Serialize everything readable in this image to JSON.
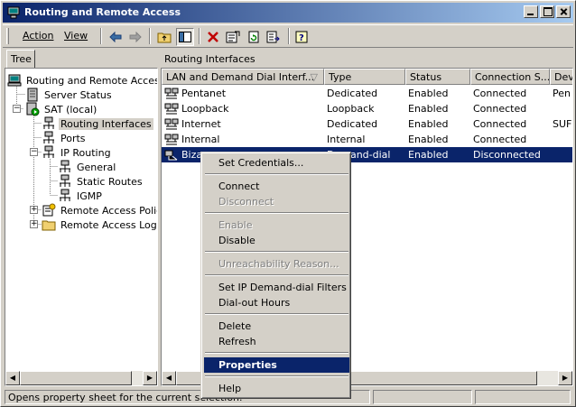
{
  "window": {
    "title": "Routing and Remote Access"
  },
  "menu": {
    "action": "Action",
    "view": "View"
  },
  "tree": {
    "tab_label": "Tree",
    "items": [
      {
        "label": "Routing and Remote Access"
      },
      {
        "label": "Server Status"
      },
      {
        "label": "SAT (local)"
      },
      {
        "label": "Routing Interfaces"
      },
      {
        "label": "Ports"
      },
      {
        "label": "IP Routing"
      },
      {
        "label": "General"
      },
      {
        "label": "Static Routes"
      },
      {
        "label": "IGMP"
      },
      {
        "label": "Remote Access Policies"
      },
      {
        "label": "Remote Access Logging"
      }
    ]
  },
  "list": {
    "pane_title": "Routing Interfaces",
    "columns": [
      "LAN and Demand Dial Interf...",
      "Type",
      "Status",
      "Connection S...",
      "Dev"
    ],
    "rows": [
      {
        "name": "Pentanet",
        "type": "Dedicated",
        "status": "Enabled",
        "connection": "Connected",
        "device": "Pen"
      },
      {
        "name": "Loopback",
        "type": "Loopback",
        "status": "Enabled",
        "connection": "Connected",
        "device": ""
      },
      {
        "name": "Internet",
        "type": "Dedicated",
        "status": "Enabled",
        "connection": "Connected",
        "device": "SUF"
      },
      {
        "name": "Internal",
        "type": "Internal",
        "status": "Enabled",
        "connection": "Connected",
        "device": ""
      },
      {
        "name": "Bizarr",
        "type": "Demand-dial",
        "status": "Enabled",
        "connection": "Disconnected",
        "device": ""
      }
    ]
  },
  "context_menu": {
    "set_credentials": "Set Credentials...",
    "connect": "Connect",
    "disconnect": "Disconnect",
    "enable": "Enable",
    "disable": "Disable",
    "unreachability": "Unreachability Reason...",
    "set_filters": "Set IP Demand-dial Filters",
    "dialout_hours": "Dial-out Hours",
    "delete": "Delete",
    "refresh": "Refresh",
    "properties": "Properties",
    "help": "Help"
  },
  "status": {
    "text": "Opens property sheet for the current selection."
  },
  "colors": {
    "title_start": "#0a246a",
    "title_end": "#a6caf0",
    "selection": "#0a246a",
    "face": "#d4d0c8"
  }
}
